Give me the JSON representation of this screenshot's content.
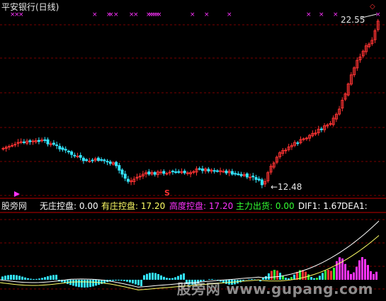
{
  "window": {
    "title": "平安银行(日线)"
  },
  "main_chart": {
    "price_high_label": "22.55",
    "price_low_label": "12.48",
    "signal_marker": "S"
  },
  "indicator_bar": {
    "site_label": "股旁网",
    "items": [
      {
        "label": "无庄控盘:",
        "value": "0.00",
        "color": "#ffffff"
      },
      {
        "label": "有庄控盘:",
        "value": "17.20",
        "color": "#ffff66"
      },
      {
        "label": "高度控盘:",
        "value": "17.20",
        "color": "#ff33ff"
      },
      {
        "label": "主力出货:",
        "value": "0.00",
        "color": "#33ff33"
      },
      {
        "label": "DIF1:",
        "value": "1.67",
        "color": "#ffffff"
      },
      {
        "label": "DEA1:",
        "value": "",
        "color": "#ffffff"
      }
    ]
  },
  "watermark": {
    "brand": "股旁网",
    "url": "www.gupang.com"
  },
  "colors": {
    "background": "#000000",
    "up_candle": "#ff3333",
    "down_candle": "#33e5ff",
    "grid": "#7a0000",
    "signal_cross": "#ff33ff"
  }
}
